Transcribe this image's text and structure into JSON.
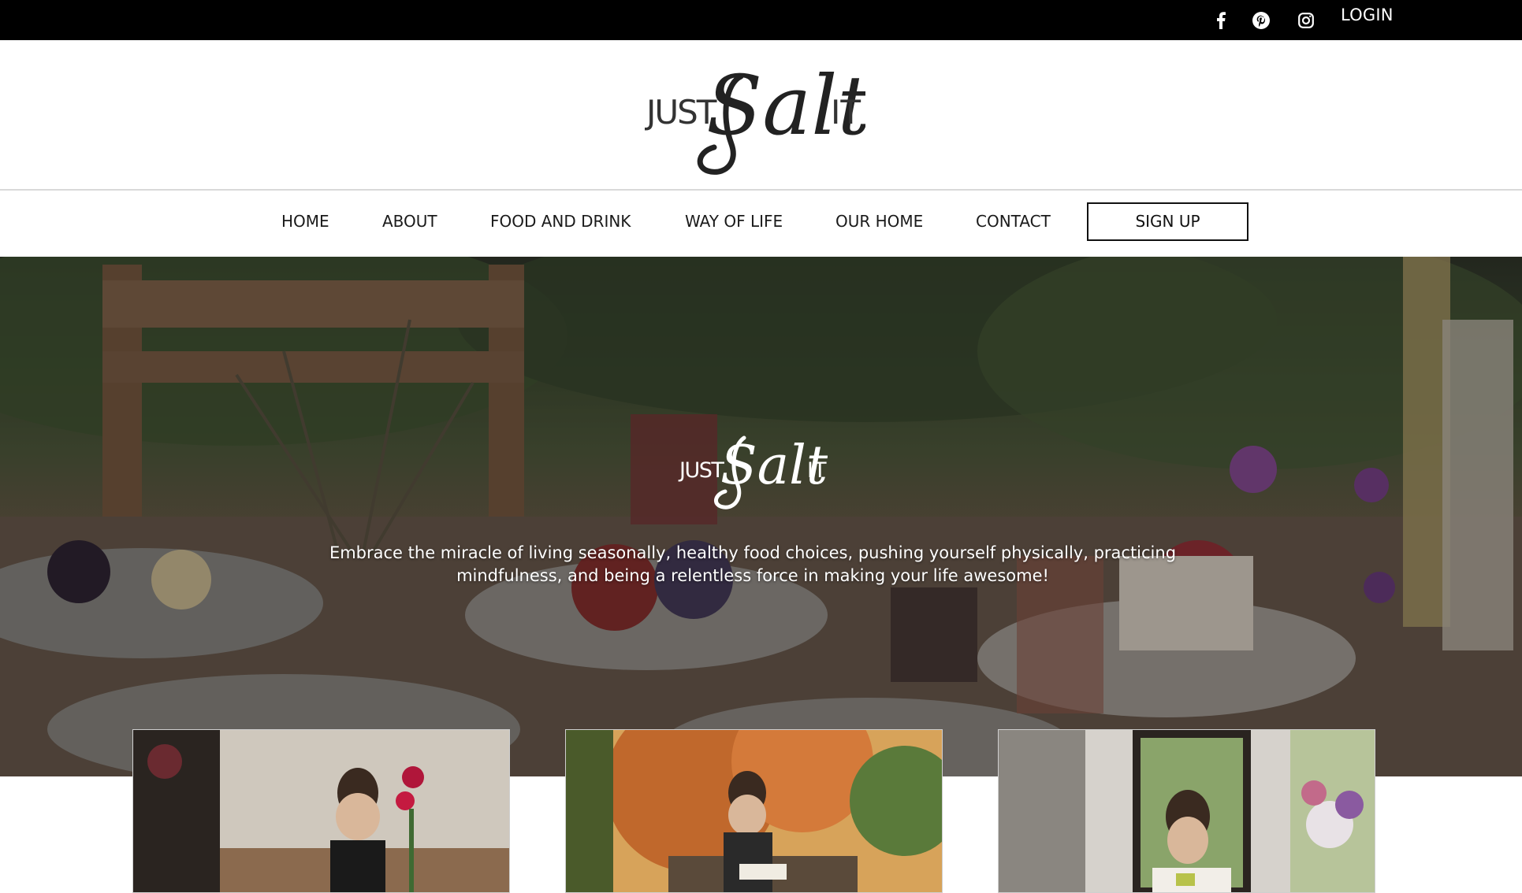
{
  "topbar": {
    "social": [
      {
        "icon": "facebook-icon",
        "label": "f"
      },
      {
        "icon": "pinterest-icon",
        "label": "p"
      },
      {
        "icon": "instagram-icon",
        "label": "ig"
      }
    ],
    "login_label": "LOGIN"
  },
  "brand": {
    "logo_small_left": "JUST",
    "logo_script": "Salt",
    "logo_small_right": "IT"
  },
  "nav": {
    "items": [
      {
        "label": "HOME"
      },
      {
        "label": "ABOUT"
      },
      {
        "label": "FOOD AND DRINK"
      },
      {
        "label": "WAY OF LIFE"
      },
      {
        "label": "OUR HOME"
      },
      {
        "label": "CONTACT"
      }
    ],
    "signup_label": "SIGN UP"
  },
  "hero": {
    "tagline": "Embrace the miracle of living seasonally, healthy food choices, pushing yourself physically, practicing mindfulness, and being a relentless force in making your life awesome!"
  },
  "cards": [
    {
      "name": "kitchen-photo"
    },
    {
      "name": "autumn-garden-photo"
    },
    {
      "name": "living-room-photo"
    }
  ],
  "colors": {
    "topbar": "#000000",
    "text": "#1a1a1a",
    "hero_text": "#ffffff"
  }
}
